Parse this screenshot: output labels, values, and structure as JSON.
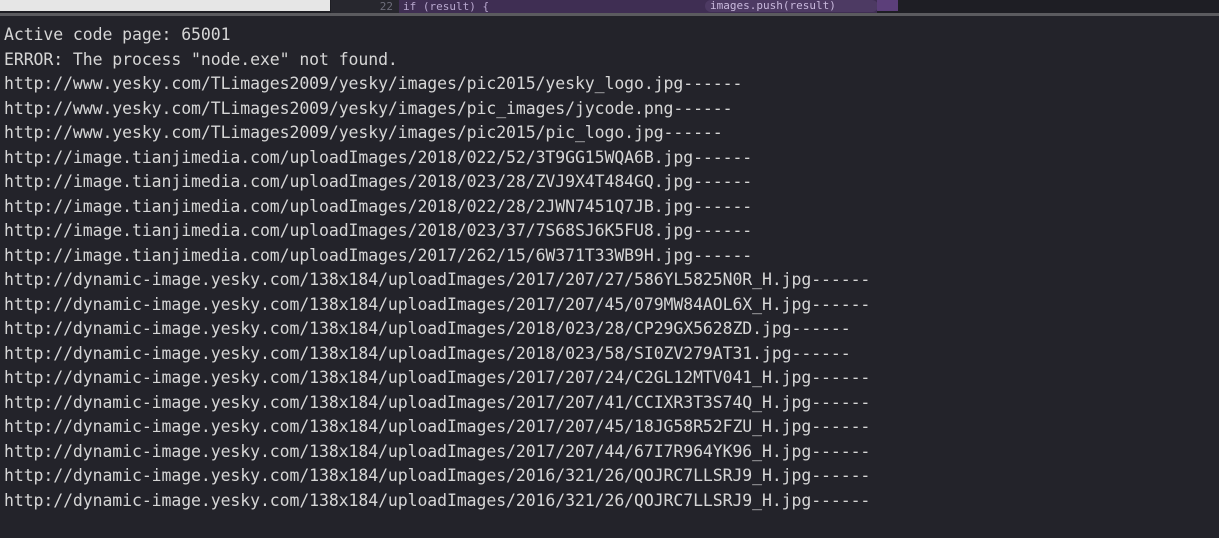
{
  "window": {
    "kind": "integrated-terminal-panel",
    "background_color": "#23232a",
    "text_color": "#d6d6d6",
    "divider_color": "#5b5b5f"
  },
  "editor_sliver": {
    "note": "top 13px of a code editor, clipped; only glyph tops visible",
    "gutter_color": "#e6e6e6",
    "linenum_bg_color": "#27272e",
    "code_bg_color": "#3f2e53",
    "pill_bg_color": "#4d3a63",
    "linenum_text": "22",
    "code_text": "if (result) {",
    "pill_text": "images.push(result)"
  },
  "terminal": {
    "lines": [
      "Active code page: 65001",
      "ERROR: The process \"node.exe\" not found.",
      "http://www.yesky.com/TLimages2009/yesky/images/pic2015/yesky_logo.jpg------",
      "http://www.yesky.com/TLimages2009/yesky/images/pic_images/jycode.png------",
      "http://www.yesky.com/TLimages2009/yesky/images/pic2015/pic_logo.jpg------",
      "http://image.tianjimedia.com/uploadImages/2018/022/52/3T9GG15WQA6B.jpg------",
      "http://image.tianjimedia.com/uploadImages/2018/023/28/ZVJ9X4T484GQ.jpg------",
      "http://image.tianjimedia.com/uploadImages/2018/022/28/2JWN7451Q7JB.jpg------",
      "http://image.tianjimedia.com/uploadImages/2018/023/37/7S68SJ6K5FU8.jpg------",
      "http://image.tianjimedia.com/uploadImages/2017/262/15/6W371T33WB9H.jpg------",
      "http://dynamic-image.yesky.com/138x184/uploadImages/2017/207/27/586YL5825N0R_H.jpg------",
      "http://dynamic-image.yesky.com/138x184/uploadImages/2017/207/45/079MW84AOL6X_H.jpg------",
      "http://dynamic-image.yesky.com/138x184/uploadImages/2018/023/28/CP29GX5628ZD.jpg------",
      "http://dynamic-image.yesky.com/138x184/uploadImages/2018/023/58/SI0ZV279AT31.jpg------",
      "http://dynamic-image.yesky.com/138x184/uploadImages/2017/207/24/C2GL12MTV041_H.jpg------",
      "http://dynamic-image.yesky.com/138x184/uploadImages/2017/207/41/CCIXR3T3S74Q_H.jpg------",
      "http://dynamic-image.yesky.com/138x184/uploadImages/2017/207/45/18JG58R52FZU_H.jpg------",
      "http://dynamic-image.yesky.com/138x184/uploadImages/2017/207/44/67I7R964YK96_H.jpg------",
      "http://dynamic-image.yesky.com/138x184/uploadImages/2016/321/26/QOJRC7LLSRJ9_H.jpg------",
      "http://dynamic-image.yesky.com/138x184/uploadImages/2016/321/26/QOJRC7LLSRJ9_H.jpg------"
    ]
  }
}
